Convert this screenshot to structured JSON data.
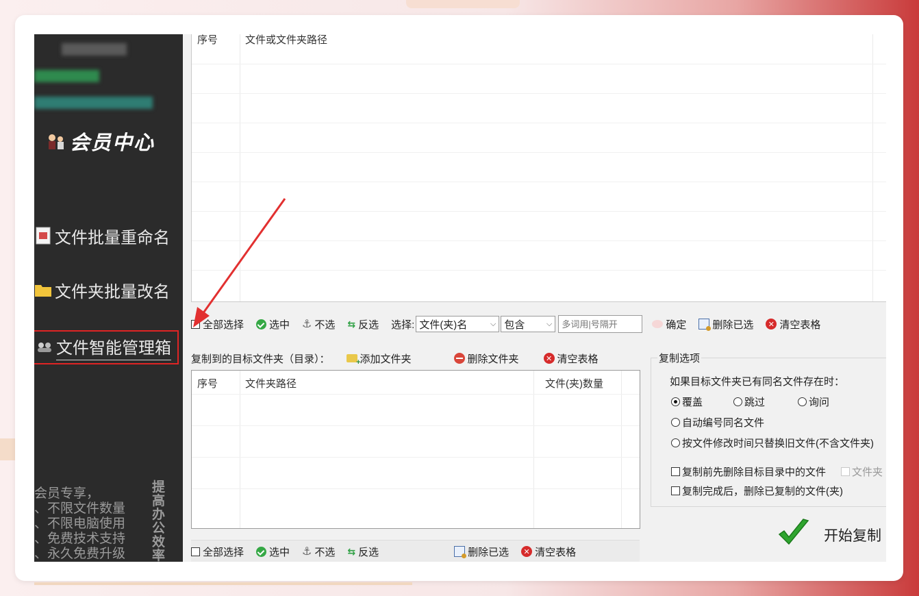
{
  "sidebar": {
    "member_center": "会员中心",
    "nav": [
      {
        "label": "文件批量重命名",
        "icon": "document-icon"
      },
      {
        "label": "文件夹批量改名",
        "icon": "folder-icon"
      },
      {
        "label": "文件智能管理箱",
        "icon": "people-icon"
      }
    ],
    "promo_lines": [
      "会员专享，",
      "、不限文件数量",
      "、不限电脑使用",
      "、免费技术支持",
      "、永久免费升级"
    ],
    "promo_vertical": "提高办公效率"
  },
  "source_table": {
    "col_index": "序号",
    "col_path": "文件或文件夹路径"
  },
  "toolbar1": {
    "select_all": "全部选择",
    "select": "选中",
    "deselect": "不选",
    "invert": "反选",
    "select_by_label": "选择:",
    "select_by_value": "文件(夹)名",
    "match_value": "包含",
    "keyword_placeholder": "多词用|号隔开",
    "confirm": "确定",
    "delete_selected": "删除已选",
    "clear_table": "清空表格"
  },
  "target_section": {
    "label": "复制到的目标文件夹（目录）：",
    "add_folder": "添加文件夹",
    "delete_folder": "删除文件夹",
    "clear_table": "清空表格",
    "col_index": "序号",
    "col_path": "文件夹路径",
    "col_count": "文件(夹)数量"
  },
  "copy_options": {
    "title": "复制选项",
    "conflict_question": "如果目标文件夹已有同名文件存在时：",
    "overwrite": "覆盖",
    "skip": "跳过",
    "ask": "询问",
    "auto_number": "自动编号同名文件",
    "replace_by_time": "按文件修改时间只替换旧文件(不含文件夹)",
    "delete_before": "复制前先删除目标目录中的文件",
    "folder_cut": "文件夹",
    "delete_after": "复制完成后，删除已复制的文件(夹)"
  },
  "toolbar2": {
    "select_all": "全部选择",
    "select": "选中",
    "deselect": "不选",
    "invert": "反选",
    "delete_selected": "删除已选",
    "clear_table": "清空表格"
  },
  "start_copy": "开始复制",
  "colors": {
    "sidebar_bg": "#2b2b2b",
    "highlight_red": "#e02424",
    "check_green": "#2fa52f"
  }
}
